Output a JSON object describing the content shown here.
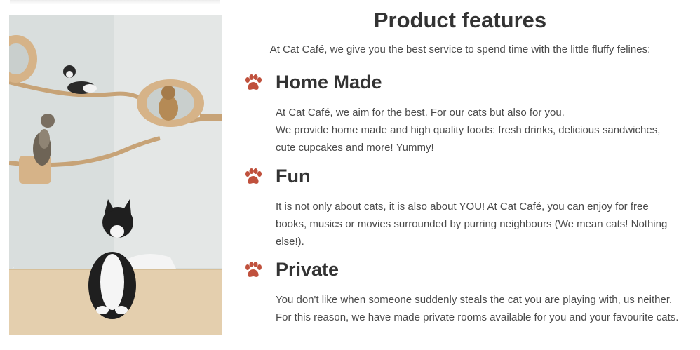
{
  "page": {
    "title": "Product features",
    "intro": "At Cat Café, we give you the best service to spend time with the little fluffy felines:"
  },
  "photo": {
    "alt": "Cats on wall shelves and a black and white cat sitting on a table"
  },
  "features": [
    {
      "icon": "paw-icon",
      "title": "Home Made",
      "text_line1": "At Cat Café, we aim for the best. For our cats but also for you.",
      "text_line2": "We provide home made and high quality foods: fresh drinks, delicious sandwiches, cute cupcakes and more! Yummy!"
    },
    {
      "icon": "paw-icon",
      "title": "Fun",
      "text": "It is not only about cats, it is also about YOU! At Cat Café, you can enjoy for free books, musics or movies surrounded by purring neighbours (We mean cats! Nothing else!)."
    },
    {
      "icon": "paw-icon",
      "title": "Private",
      "text": "You don't like when someone suddenly steals the cat you are playing with, us neither. For this reason, we have made private rooms available for you and your favourite cats."
    }
  ],
  "colors": {
    "accent": "#c0513d",
    "heading": "#333333",
    "body_text": "#4a4a4a"
  }
}
